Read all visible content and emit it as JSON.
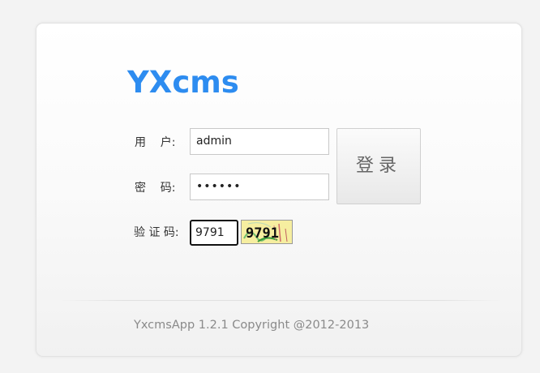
{
  "logo": {
    "text": "YXcms",
    "color": "#2d8cf0"
  },
  "form": {
    "username_label": "用    户:",
    "username_value": "admin",
    "password_label": "密    码:",
    "password_value": "••••••",
    "captcha_label": "验 证 码:",
    "captcha_value": "9791",
    "captcha_image_text": "9791",
    "login_button": "登录"
  },
  "footer": {
    "copyright": "YxcmsApp 1.2.1 Copyright @2012-2013"
  }
}
